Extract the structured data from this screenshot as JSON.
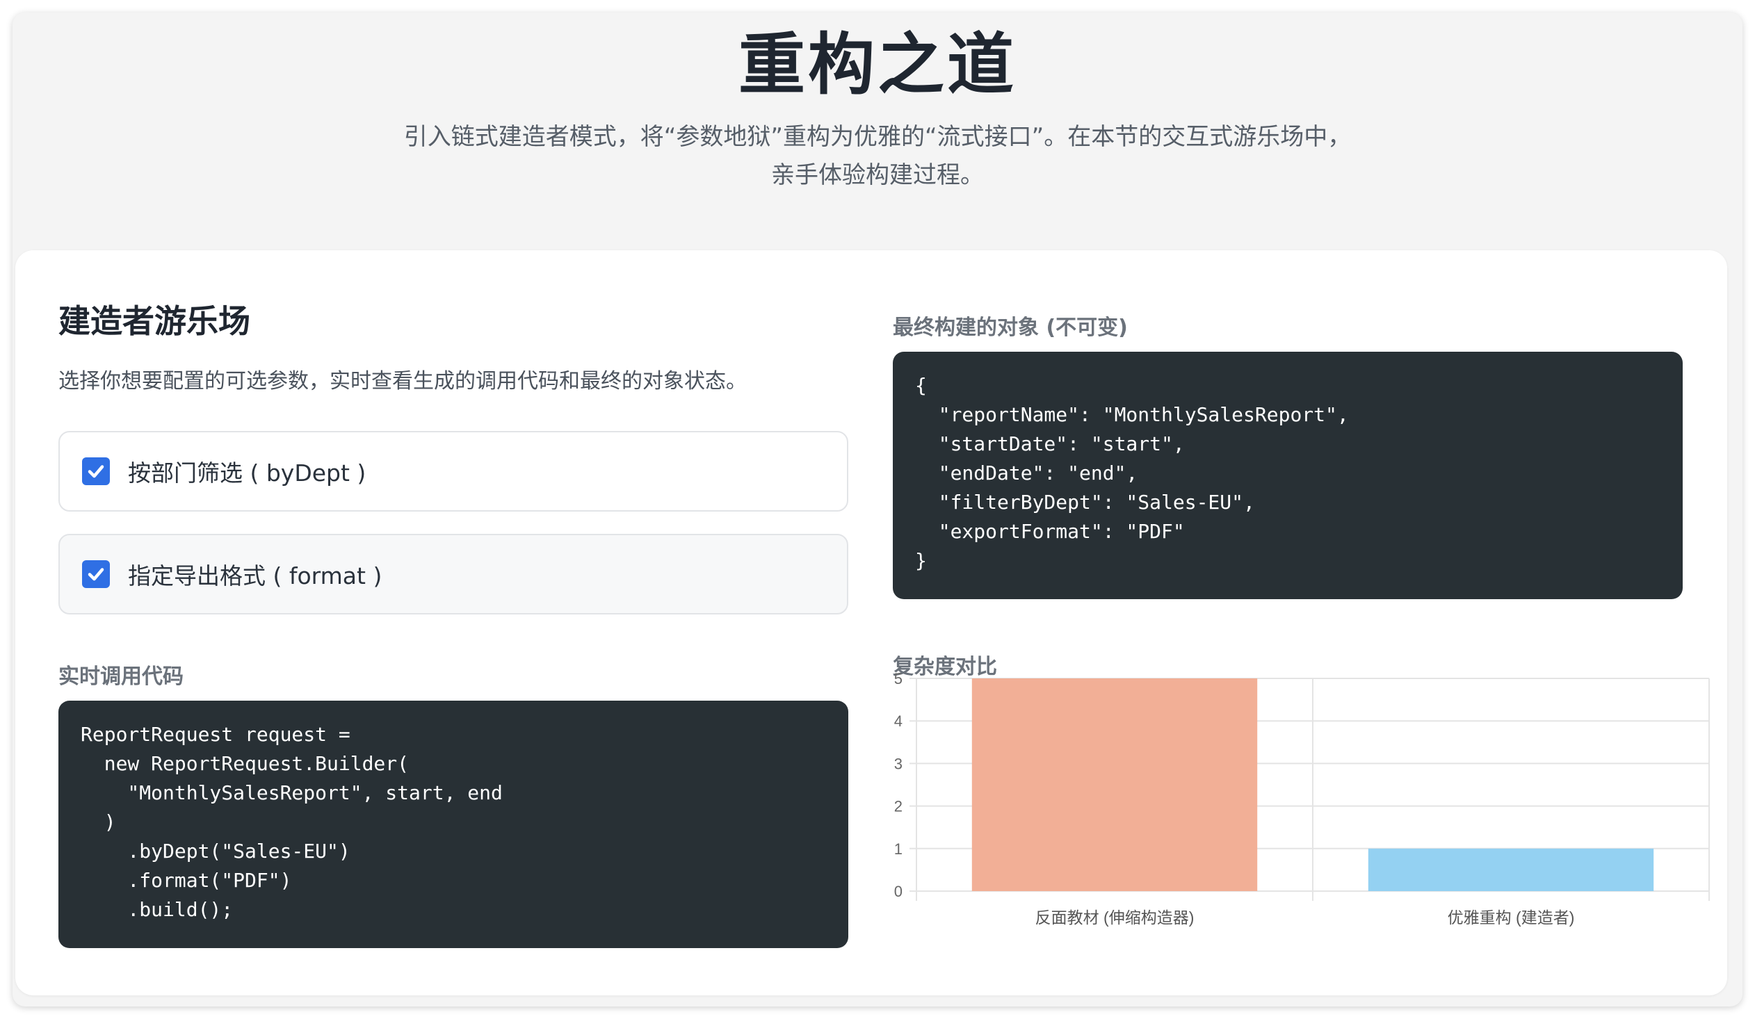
{
  "header": {
    "title": "重构之道",
    "subtitle_line1": "引入链式建造者模式，将“参数地狱”重构为优雅的“流式接口”。在本节的交互式游乐场中，",
    "subtitle_line2": "亲手体验构建过程。"
  },
  "playground": {
    "title": "建造者游乐场",
    "description": "选择你想要配置的可选参数，实时查看生成的调用代码和最终的对象状态。",
    "options": [
      {
        "label": "按部门筛选 ( byDept )",
        "checked": true
      },
      {
        "label": "指定导出格式 ( format )",
        "checked": true
      }
    ],
    "code_label": "实时调用代码",
    "code": "ReportRequest request =\n  new ReportRequest.Builder(\n    \"MonthlySalesReport\", start, end\n  )\n    .byDept(\"Sales-EU\")\n    .format(\"PDF\")\n    .build();"
  },
  "result": {
    "label": "最终构建的对象 (不可变)",
    "json": "{\n  \"reportName\": \"MonthlySalesReport\",\n  \"startDate\": \"start\",\n  \"endDate\": \"end\",\n  \"filterByDept\": \"Sales-EU\",\n  \"exportFormat\": \"PDF\"\n}"
  },
  "complexity": {
    "label": "复杂度对比"
  },
  "colors": {
    "accent": "#2f6fe4",
    "code_bg": "#283035",
    "bar_1": "#f2af96",
    "bar_2": "#94d1f2"
  },
  "chart_data": {
    "type": "bar",
    "categories": [
      "反面教材 (伸缩构造器)",
      "优雅重构 (建造者)"
    ],
    "values": [
      5,
      1
    ],
    "colors": [
      "#f2af96",
      "#94d1f2"
    ],
    "ylim": [
      0,
      5
    ],
    "yticks": [
      "0",
      "1",
      "2",
      "3",
      "4",
      "5"
    ],
    "grid": true,
    "legend": "none"
  }
}
